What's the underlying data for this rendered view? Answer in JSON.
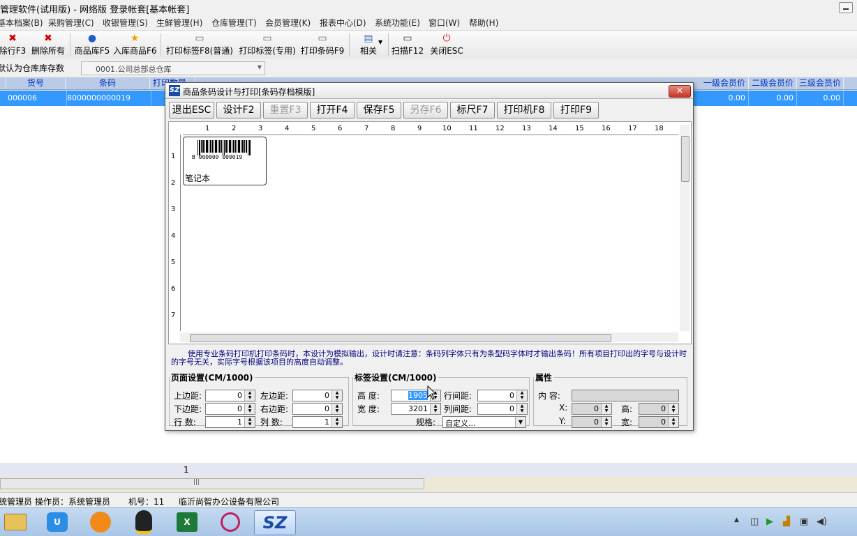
{
  "app_title": "管理软件(试用版) - 网络版  登录帐套[基本帐套]",
  "menus": [
    "基本档案(B)",
    "采购管理(C)",
    "收银管理(S)",
    "生鲜管理(H)",
    "仓库管理(T)",
    "会员管理(K)",
    "报表中心(D)",
    "系统功能(E)",
    "窗口(W)",
    "帮助(H)"
  ],
  "toolbar": {
    "delete_row": "除行F3",
    "delete_all": "删除所有",
    "product_lib": "商品库F5",
    "stock_in": "入库商品F6",
    "print_label_normal": "打印标签F8(普通)",
    "print_label_special": "打印标签(专用)",
    "print_barcode": "打印条码F9",
    "related": "相关",
    "scan": "扫描F12",
    "close": "关闭ESC"
  },
  "filter": {
    "label": "默认为仓库库存数",
    "warehouse": "0001.公司总部总仓库"
  },
  "grid": {
    "headers": [
      "货号",
      "条码",
      "打印数量",
      "一级会员价",
      "二级会员价",
      "三级会员价"
    ],
    "row": {
      "code": "000006",
      "barcode": "8000000000019",
      "member1": "0.00",
      "member2": "0.00",
      "member3": "0.00"
    },
    "footer_count": "1"
  },
  "status": {
    "user_suffix": "统管理员",
    "operator": "操作员：系统管理员",
    "machine": "机号：11",
    "company": "临沂尚智办公设备有限公司"
  },
  "dialog": {
    "title": "商品条码设计与打印[条码存档模版]",
    "buttons": {
      "exit": "退出ESC",
      "design": "设计F2",
      "reset": "重置F3",
      "open": "打开F4",
      "save": "保存F5",
      "save_as": "另存F6",
      "ruler": "标尺F7",
      "printer": "打印机F8",
      "print": "打印F9"
    },
    "label_preview": {
      "barcode_digits": "B  000000 000019",
      "product_name": "笔记本"
    },
    "notice": "使用专业条码打印机打印条码时，本设计为模拟输出，设计时请注意：条码列字体只有为条型码字体时才输出条码！所有项目打印出的字号与设计时的字号无关，实际字号根据该项目的高度自动调整。",
    "page_settings": {
      "title": "页面设置(CM/1000)",
      "top_margin_label": "上边距:",
      "top_margin": "0",
      "left_margin_label": "左边距:",
      "left_margin": "0",
      "bottom_margin_label": "下边距:",
      "bottom_margin": "0",
      "right_margin_label": "右边距:",
      "right_margin": "0",
      "rows_label": "行  数:",
      "rows": "1",
      "cols_label": "列  数:",
      "cols": "1"
    },
    "label_settings": {
      "title": "标签设置(CM/1000)",
      "height_label": "高  度:",
      "height": "1905",
      "row_gap_label": "行间距:",
      "row_gap": "0",
      "width_label": "宽  度:",
      "width": "3201",
      "col_gap_label": "列间距:",
      "col_gap": "0",
      "spec_label": "规格:",
      "spec": "自定义..."
    },
    "properties": {
      "title": "属性",
      "content_label": "内  容:",
      "x_label": "X:",
      "x": "0",
      "h_label": "高:",
      "h": "0",
      "y_label": "Y:",
      "y": "0",
      "w_label": "宽:",
      "w": "0"
    }
  }
}
